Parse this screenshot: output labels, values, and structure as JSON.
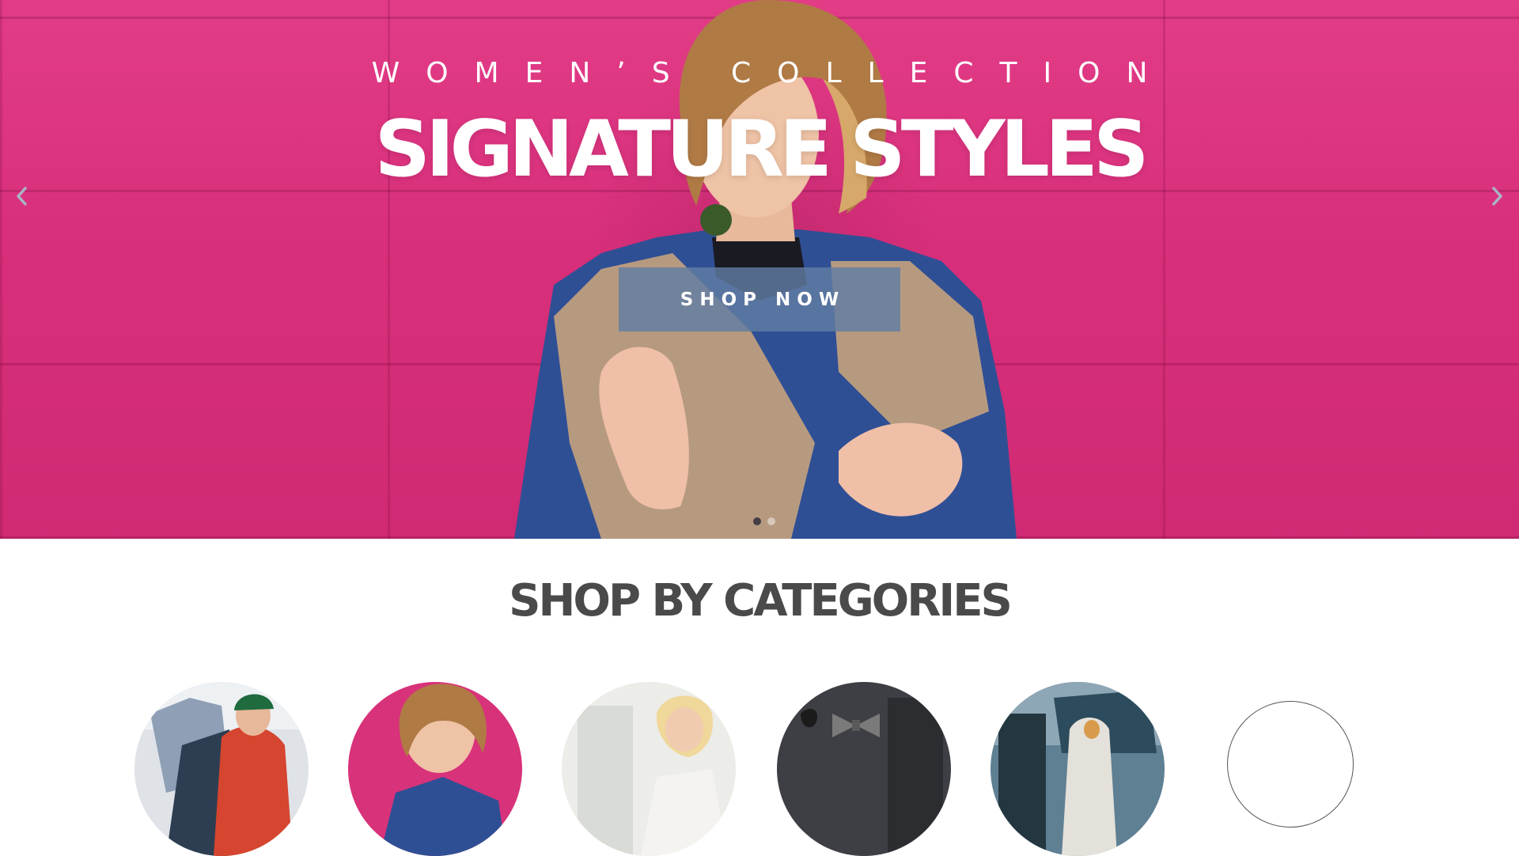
{
  "hero": {
    "eyebrow": "WOMEN’S COLLECTION",
    "title": "SIGNATURE STYLES",
    "cta_label": "SHOP NOW",
    "prev_icon": "chevron-left-icon",
    "next_icon": "chevron-right-icon",
    "slides_total": 2,
    "active_slide": 1
  },
  "categories": {
    "heading": "SHOP BY CATEGORIES",
    "items": [
      {
        "icon": "outdoor-photo"
      },
      {
        "icon": "women-photo"
      },
      {
        "icon": "blonde-photo"
      },
      {
        "icon": "accessories-photo"
      },
      {
        "icon": "urban-photo"
      },
      {
        "icon": "outline-circle"
      }
    ]
  },
  "colors": {
    "hero_pink": "#d8327a",
    "cta_bg": "#627ca2",
    "heading_text": "#4a4a4a"
  }
}
